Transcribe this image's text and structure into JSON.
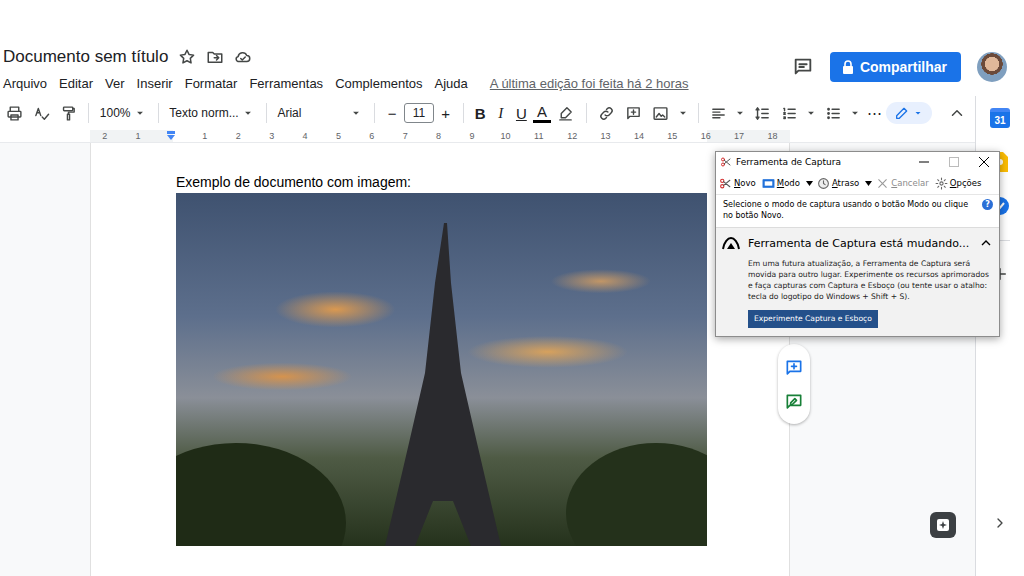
{
  "document": {
    "title": "Documento sem título"
  },
  "menu": [
    "Arquivo",
    "Editar",
    "Ver",
    "Inserir",
    "Formatar",
    "Ferramentas",
    "Complementos",
    "Ajuda"
  ],
  "last_edit": "A última edição foi feita há 2 horas",
  "share_button": "Compartilhar",
  "toolbar": {
    "zoom": "100%",
    "style": "Texto norm...",
    "font": "Arial",
    "decrease": "−",
    "font_size": "11",
    "increase": "+",
    "bold": "B",
    "italic": "I",
    "underline": "U",
    "text_color": "A",
    "more": "⋯"
  },
  "ruler": {
    "left": [
      "2",
      "1"
    ],
    "right": [
      "1",
      "2",
      "3",
      "4",
      "5",
      "6",
      "7",
      "8",
      "9",
      "10",
      "11",
      "12",
      "13",
      "14",
      "15",
      "16",
      "17",
      "18"
    ]
  },
  "page": {
    "text": "Exemplo de documento com imagem:"
  },
  "side_panel": {
    "calendar_day": "31"
  },
  "snip": {
    "title": "Ferramenta de Captura",
    "tools": [
      {
        "label": "Novo",
        "disabled": false,
        "dropdown": false
      },
      {
        "label": "Modo",
        "disabled": false,
        "dropdown": true
      },
      {
        "label": "Atraso",
        "disabled": false,
        "dropdown": true
      },
      {
        "label": "Cancelar",
        "disabled": true,
        "dropdown": false
      },
      {
        "label": "Opções",
        "disabled": false,
        "dropdown": false
      }
    ],
    "hint": "Selecione o modo de captura usando o botão Modo ou clique no botão Novo.",
    "help": "?",
    "notice": {
      "title": "Ferramenta de Captura está mudando...",
      "expanded": true,
      "body": "Em uma futura atualização, a Ferramenta de Captura será movida para outro lugar. Experimente os recursos aprimorados e faça capturas com Captura e Esboço (ou tente usar o atalho: tecla do logotipo do Windows + Shift + S).",
      "button": "Experimente Captura e Esboço"
    }
  }
}
